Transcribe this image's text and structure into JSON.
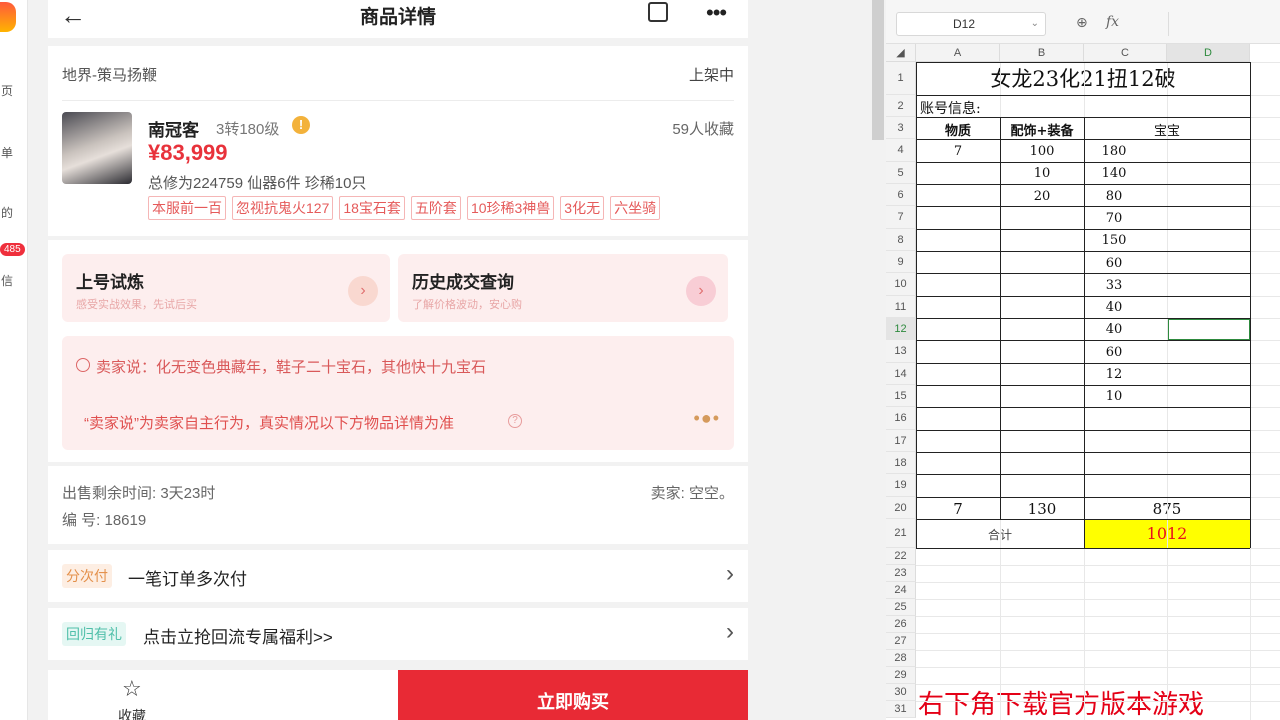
{
  "left_strip": {
    "items": [
      "页",
      "单",
      "的",
      "信"
    ],
    "badge": "485"
  },
  "header": {
    "title": "商品详情"
  },
  "product": {
    "realm": "地界-策马扬鞭",
    "status": "上架中",
    "role_name": "南冠客",
    "role_level": "3转180级",
    "favorites": "59人收藏",
    "price": "¥83,999",
    "summary": "总修为224759  仙器6件  珍稀10只",
    "tags": [
      "本服前一百",
      "忽视抗鬼火127",
      "18宝石套",
      "五阶套",
      "10珍稀3神兽",
      "3化无",
      "六坐骑"
    ]
  },
  "actions": [
    {
      "title": "上号试炼",
      "subtitle": "感受实战效果，先试后买"
    },
    {
      "title": "历史成交查询",
      "subtitle": "了解价格波动，安心购"
    }
  ],
  "seller_note": {
    "says": "卖家说：化无变色典藏年，鞋子二十宝石，其他快十九宝石",
    "disclaimer": "“卖家说”为卖家自主行为，真实情况以下方物品详情为准"
  },
  "info": {
    "sale_time": "出售剩余时间: 3天23时",
    "seller": "卖家: 空空。",
    "serial": "编 号: 18619"
  },
  "rows": [
    {
      "tag": "分次付",
      "text": "一笔订单多次付"
    },
    {
      "tag": "回归有礼",
      "text": "点击立抢回流专属福利>>"
    }
  ],
  "bottom": {
    "favorite_label": "收藏",
    "buy_label": "立即购买"
  },
  "sheet": {
    "name_box": "D12",
    "fx": "fx",
    "columns": [
      "A",
      "B",
      "C",
      "D"
    ],
    "row_numbers": [
      "1",
      "2",
      "3",
      "4",
      "5",
      "6",
      "7",
      "8",
      "9",
      "10",
      "11",
      "12",
      "13",
      "14",
      "15",
      "16",
      "17",
      "18",
      "19",
      "20",
      "21",
      "22",
      "23",
      "24",
      "25",
      "26",
      "27",
      "28",
      "29",
      "30",
      "31"
    ],
    "title": "女龙23化21扭12破",
    "account_label": "账号信息:",
    "headers": [
      "物质",
      "配饰+装备",
      "宝宝"
    ],
    "col_a": [
      "7"
    ],
    "col_b": [
      "100",
      "10",
      "20"
    ],
    "col_c": [
      "180",
      "140",
      "80",
      "70",
      "150",
      "60",
      "33",
      "40",
      "40",
      "60",
      "12",
      "10"
    ],
    "sums": [
      "7",
      "130",
      "875"
    ],
    "total_label": "合计",
    "total_value": "1012",
    "watermark": "右下角下载官方版本游戏",
    "accent": "#ffff00",
    "selection_color": "#2e8a3e"
  }
}
